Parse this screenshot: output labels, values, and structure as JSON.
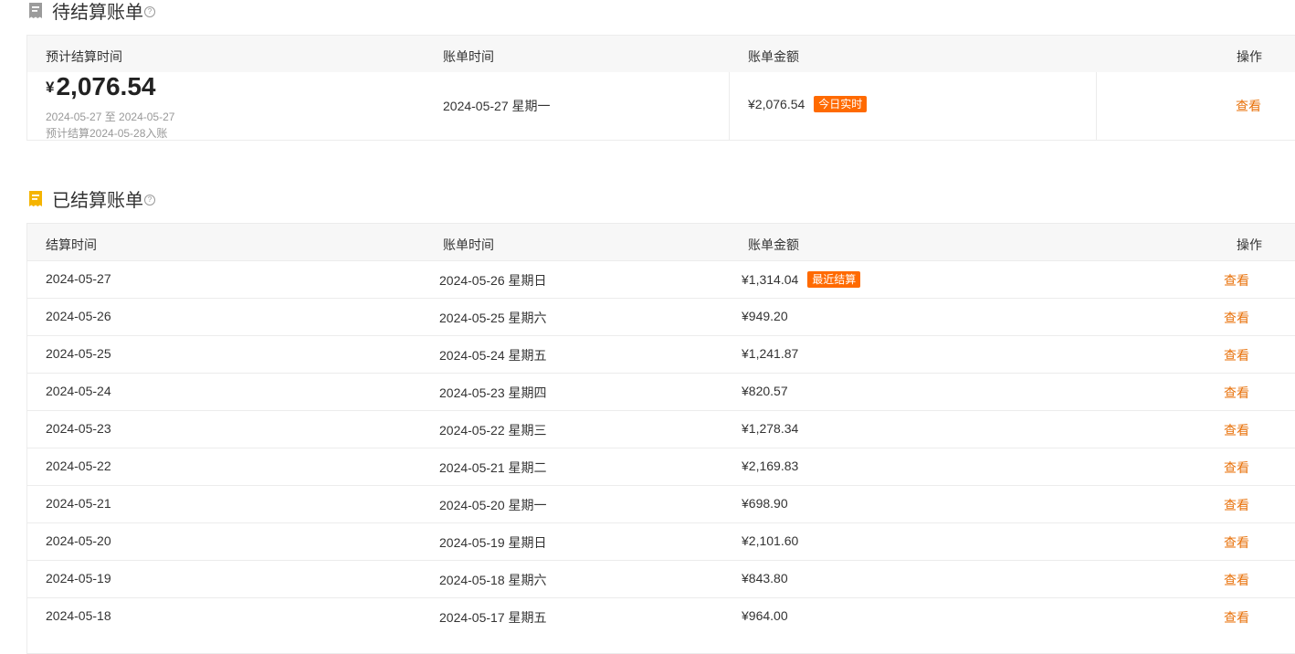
{
  "pending": {
    "title": "待结算账单",
    "help": "?",
    "headers": {
      "expected_time": "预计结算时间",
      "bill_time": "账单时间",
      "amount": "账单金额",
      "action": "操作"
    },
    "currency": "¥",
    "big_amount": "2,076.54",
    "range": "2024-05-27 至 2024-05-27",
    "note": "预计结算2024-05-28入账",
    "bill_time": "2024-05-27 星期一",
    "amount": "¥2,076.54",
    "tag": "今日实时",
    "action": "查看"
  },
  "settled": {
    "title": "已结算账单",
    "help": "?",
    "headers": {
      "settle_time": "结算时间",
      "bill_time": "账单时间",
      "amount": "账单金额",
      "action": "操作"
    },
    "rows": [
      {
        "settle": "2024-05-27",
        "bill": "2024-05-26 星期日",
        "amount": "¥1,314.04",
        "tag": "最近结算",
        "action": "查看"
      },
      {
        "settle": "2024-05-26",
        "bill": "2024-05-25 星期六",
        "amount": "¥949.20",
        "tag": "",
        "action": "查看"
      },
      {
        "settle": "2024-05-25",
        "bill": "2024-05-24 星期五",
        "amount": "¥1,241.87",
        "tag": "",
        "action": "查看"
      },
      {
        "settle": "2024-05-24",
        "bill": "2024-05-23 星期四",
        "amount": "¥820.57",
        "tag": "",
        "action": "查看"
      },
      {
        "settle": "2024-05-23",
        "bill": "2024-05-22 星期三",
        "amount": "¥1,278.34",
        "tag": "",
        "action": "查看"
      },
      {
        "settle": "2024-05-22",
        "bill": "2024-05-21 星期二",
        "amount": "¥2,169.83",
        "tag": "",
        "action": "查看"
      },
      {
        "settle": "2024-05-21",
        "bill": "2024-05-20 星期一",
        "amount": "¥698.90",
        "tag": "",
        "action": "查看"
      },
      {
        "settle": "2024-05-20",
        "bill": "2024-05-19 星期日",
        "amount": "¥2,101.60",
        "tag": "",
        "action": "查看"
      },
      {
        "settle": "2024-05-19",
        "bill": "2024-05-18 星期六",
        "amount": "¥843.80",
        "tag": "",
        "action": "查看"
      },
      {
        "settle": "2024-05-18",
        "bill": "2024-05-17 星期五",
        "amount": "¥964.00",
        "tag": "",
        "action": "查看"
      }
    ]
  },
  "colors": {
    "accent": "#ff6a00",
    "link": "#e8710a",
    "settled_icon": "#f5b400",
    "pending_icon": "#9b9b9b"
  }
}
